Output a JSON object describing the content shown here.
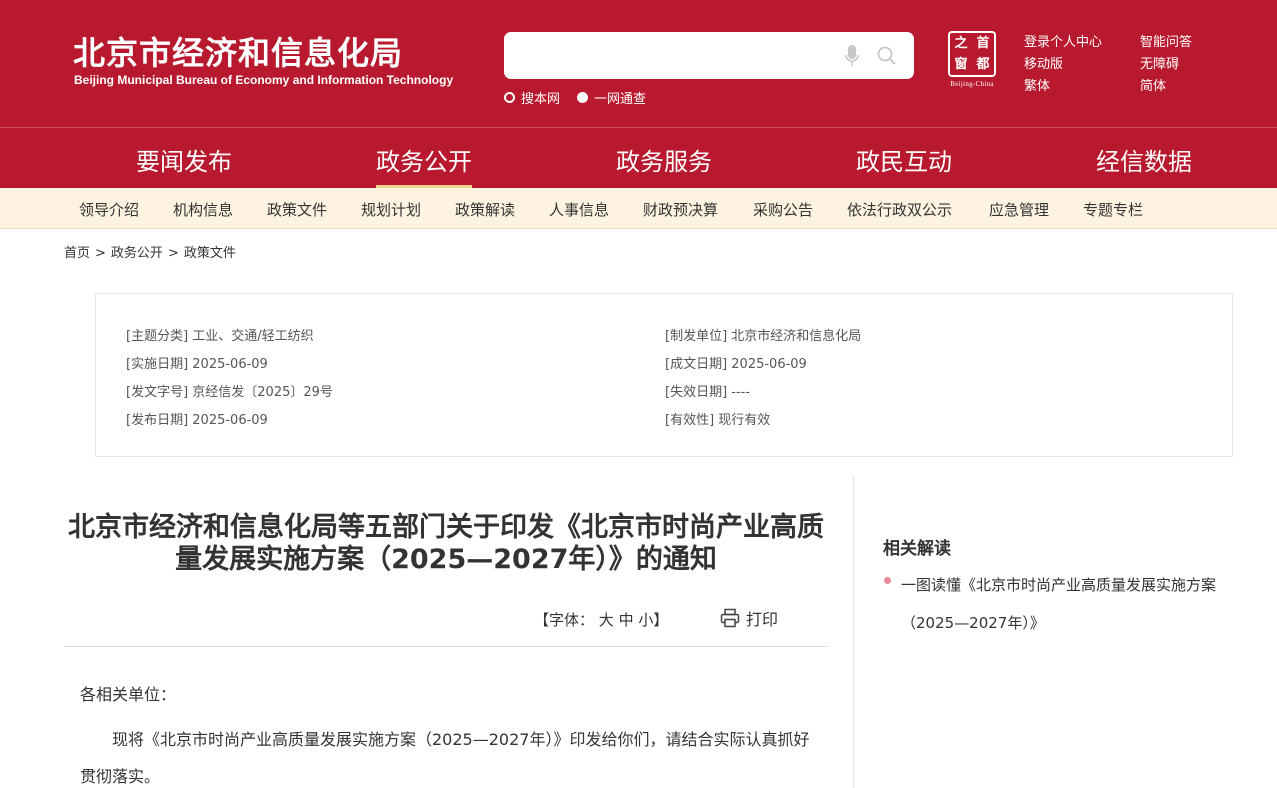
{
  "header": {
    "title_cn": "北京市经济和信息化局",
    "title_en": "Beijing Municipal Bureau of Economy and Information Technology",
    "brand_color": "#b8192e",
    "search": {
      "placeholder": "",
      "scope_options": [
        {
          "label": "搜本网",
          "selected": true
        },
        {
          "label": "一网通查",
          "selected": false
        }
      ]
    },
    "seal": {
      "chars": [
        "之",
        "首",
        "窗",
        "都"
      ],
      "caption": "Beijing-China"
    },
    "tools": {
      "login": "登录个人中心",
      "qa": "智能问答",
      "mobile": "移动版",
      "accessible": "无障碍",
      "traditional": "繁体",
      "simplified": "简体"
    }
  },
  "main_nav": {
    "items": [
      "要闻发布",
      "政务公开",
      "政务服务",
      "政民互动",
      "经信数据"
    ],
    "active": "政务公开",
    "underline_color": "#f3d38c"
  },
  "sub_nav": {
    "items": [
      "领导介绍",
      "机构信息",
      "政策文件",
      "规划计划",
      "政策解读",
      "人事信息",
      "财政预决算",
      "采购公告",
      "依法行政双公示",
      "应急管理",
      "专题专栏"
    ],
    "background": "#fdf3e0"
  },
  "breadcrumb": {
    "items": [
      "首页",
      "政务公开",
      "政策文件"
    ],
    "separator": ">"
  },
  "meta": {
    "topic": "[主题分类] 工业、交通/轻工纺织",
    "effective_date": "[实施日期] 2025-06-09",
    "doc_number": "[发文字号] 京经信发〔2025〕29号",
    "publish_date": "[发布日期] 2025-06-09",
    "issuer": "[制发单位] 北京市经济和信息化局",
    "written_date": "[成文日期] 2025-06-09",
    "expiry_date": "[失效日期] ----",
    "validity": "[有效性] 现行有效"
  },
  "article": {
    "title": "北京市经济和信息化局等五部门关于印发《北京市时尚产业高质量发展实施方案（2025—2027年）》的通知",
    "font_size_label": "【字体：",
    "font_size_options": [
      "大",
      "中",
      "小"
    ],
    "font_size_close": "】",
    "print_label": "打印",
    "salutation": "各相关单位：",
    "paragraph": "现将《北京市时尚产业高质量发展实施方案（2025—2027年）》印发给你们，请结合实际认真抓好贯彻落实。"
  },
  "sidebar": {
    "title": "相关解读",
    "links": [
      "一图读懂《北京市时尚产业高质量发展实施方案（2025—2027年）》"
    ]
  }
}
